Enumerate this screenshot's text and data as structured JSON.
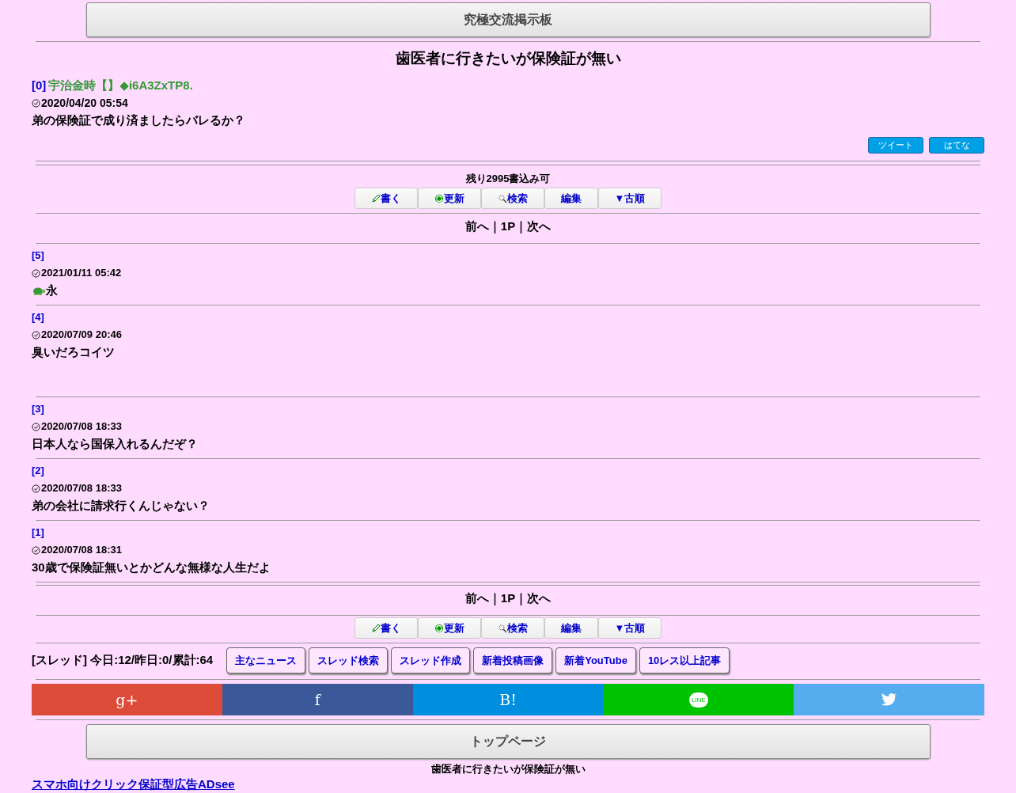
{
  "board_title": "究極交流掲示板",
  "thread_title": "歯医者に行きたいが保険証が無い",
  "first_post": {
    "number": "[0]",
    "name": "宇治金時【】◆i6A3ZxTP8.",
    "date": "2020/04/20 05:54",
    "body": "弟の保険証で成り済ましたらバレるか？"
  },
  "share_small": [
    "ツイート",
    "はてな"
  ],
  "remaining": "残り2995書込み可",
  "toolbar": [
    {
      "kind": "pencil",
      "label": "書く"
    },
    {
      "kind": "refresh",
      "label": "更新"
    },
    {
      "kind": "search",
      "label": "検索"
    },
    {
      "kind": "plain",
      "label": "編集"
    },
    {
      "kind": "plain",
      "label": "▼古順"
    }
  ],
  "pager": "前へ｜1P｜次へ",
  "posts": [
    {
      "number": "[5]",
      "date": "2021/01/11 05:42",
      "turtle": true,
      "body": "永",
      "tall": false
    },
    {
      "number": "[4]",
      "date": "2020/07/09 20:46",
      "turtle": false,
      "body": "臭いだろコイツ",
      "tall": true
    },
    {
      "number": "[3]",
      "date": "2020/07/08 18:33",
      "turtle": false,
      "body": "日本人なら国保入れるんだぞ？",
      "tall": false
    },
    {
      "number": "[2]",
      "date": "2020/07/08 18:33",
      "turtle": false,
      "body": "弟の会社に請求行くんじゃない？",
      "tall": false
    },
    {
      "number": "[1]",
      "date": "2020/07/08 18:31",
      "turtle": false,
      "body": "30歳で保険証無いとかどんな無様な人生だよ",
      "tall": false
    }
  ],
  "pager_bottom": "前へ｜1P｜次へ",
  "toolbar_bottom": [
    {
      "kind": "pencil",
      "label": "書く"
    },
    {
      "kind": "refresh",
      "label": "更新"
    },
    {
      "kind": "search",
      "label": "検索"
    },
    {
      "kind": "plain",
      "label": "編集"
    },
    {
      "kind": "plain",
      "label": "▼古順"
    }
  ],
  "stats": "[スレッド] 今日:12/昨日:0/累計:64",
  "links": [
    "主なニュース",
    "スレッド検索",
    "スレッド作成",
    "新着投稿画像",
    "新着YouTube",
    "10レス以上記事"
  ],
  "share_bar": [
    {
      "kind": "text",
      "label": "g+",
      "color": "#dd4b39"
    },
    {
      "kind": "text",
      "label": "f",
      "color": "#3b5998"
    },
    {
      "kind": "text",
      "label": "B!",
      "color": "#008fde"
    },
    {
      "kind": "line",
      "label": "LINE",
      "color": "#00c300"
    },
    {
      "kind": "bird",
      "color": "#55acee"
    }
  ],
  "top_page": "トップページ",
  "footer_title": "歯医者に行きたいが保険証が無い",
  "ad_link": "スマホ向けクリック保証型広告ADsee"
}
